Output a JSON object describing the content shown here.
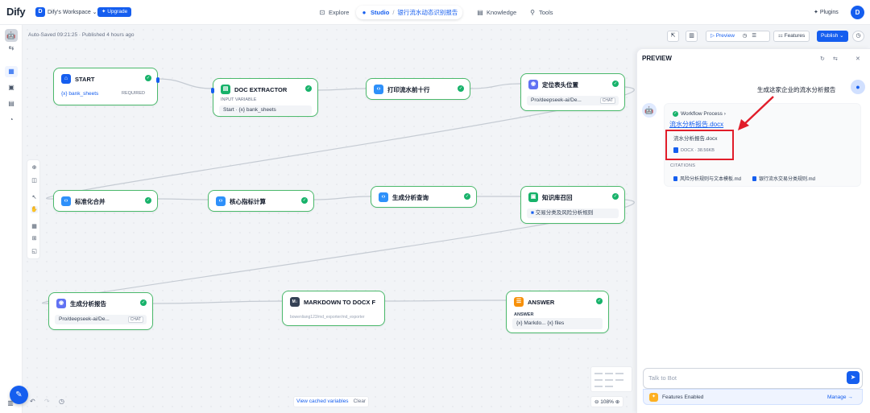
{
  "app": {
    "logo": "Dify",
    "workspace_initial": "D",
    "workspace_name": "Dify's Workspace ⌄",
    "upgrade_label": "✦ Upgrade"
  },
  "nav": {
    "explore": "Explore",
    "studio": "Studio",
    "app_name": "银行流水动态识别报告",
    "knowledge": "Knowledge",
    "tools": "Tools",
    "plugins": "Plugins",
    "user_initial": "D"
  },
  "toolbar": {
    "autosave": "Auto-Saved 09:21:25 · Published 4 hours ago",
    "preview": "▷ Preview",
    "features": "Features",
    "publish": "Publish ⌄"
  },
  "nodes": {
    "start": {
      "title": "START",
      "var": "{x} bank_sheets",
      "req": "REQUIRED"
    },
    "doc_extractor": {
      "title": "DOC EXTRACTOR",
      "sub": "INPUT VARIABLE",
      "var": "Start · {x} bank_sheets"
    },
    "print_rows": {
      "title": "打印流水前十行"
    },
    "locate_header": {
      "title": "定位表头位置",
      "model": "Pro/deepseek-ai/De...",
      "tag": "CHAT"
    },
    "normalize": {
      "title": "标准化合并"
    },
    "core_metrics": {
      "title": "核心指标计算"
    },
    "gen_query": {
      "title": "生成分析查询"
    },
    "kb_retrieval": {
      "title": "知识库召回",
      "kb": "交易分类及风险分析规则"
    },
    "gen_report": {
      "title": "生成分析报告",
      "model": "Pro/deepseek-ai/De...",
      "tag": "CHAT"
    },
    "md_to_docx": {
      "title": "MARKDOWN TO DOCX F",
      "plugin": "bowenliang123/md_exporter/md_exporter"
    },
    "answer": {
      "title": "ANSWER",
      "sub": "ANSWER",
      "vars": "{x} Markdo...  {x} files"
    }
  },
  "canvas_footer": {
    "view_cached": "View cached variables",
    "clear": "Clear",
    "zoom": "108%"
  },
  "preview": {
    "title": "PREVIEW",
    "user_message": "生成这家企业的流水分析报告",
    "workflow_process": "Workflow Process ›",
    "file_link": "流水分析报告.docx",
    "file_name": "流水分析报告.docx",
    "file_meta": "DOCX · 38.56KB",
    "citations_label": "CITATIONS",
    "citations": [
      "风险分析规则与文本模板.md",
      "银行流水交易分类规则.md"
    ],
    "input_placeholder": "Talk to Bot",
    "features_enabled": "Features Enabled",
    "manage": "Manage →"
  },
  "colors": {
    "accent": "#155eef",
    "node_border": "#4bb96c",
    "highlight": "#e11d2a"
  }
}
